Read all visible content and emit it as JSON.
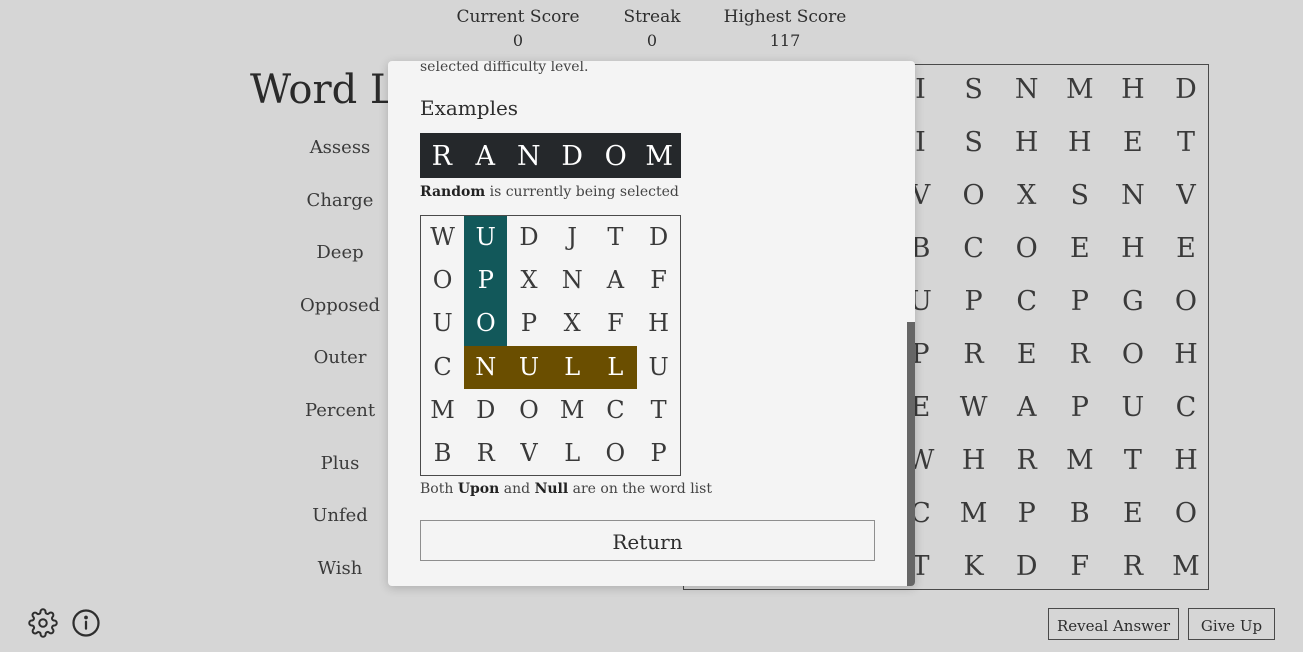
{
  "scores": {
    "current": {
      "label": "Current Score",
      "value": "0"
    },
    "streak": {
      "label": "Streak",
      "value": "0"
    },
    "highest": {
      "label": "Highest Score",
      "value": "117"
    }
  },
  "title": "Word List",
  "words": [
    "Assess",
    "Charge",
    "Deep",
    "Opposed",
    "Outer",
    "Percent",
    "Plus",
    "Unfed",
    "Wish"
  ],
  "grid": [
    [
      "I",
      "S",
      "N",
      "M",
      "H",
      "D"
    ],
    [
      "I",
      "S",
      "H",
      "H",
      "E",
      "T"
    ],
    [
      "V",
      "O",
      "X",
      "S",
      "N",
      "V"
    ],
    [
      "B",
      "C",
      "O",
      "E",
      "H",
      "E"
    ],
    [
      "U",
      "P",
      "C",
      "P",
      "G",
      "O"
    ],
    [
      "P",
      "R",
      "E",
      "R",
      "O",
      "H"
    ],
    [
      "E",
      "W",
      "A",
      "P",
      "U",
      "C"
    ],
    [
      "W",
      "H",
      "R",
      "M",
      "T",
      "H"
    ],
    [
      "C",
      "M",
      "P",
      "B",
      "E",
      "O"
    ],
    [
      "T",
      "K",
      "D",
      "F",
      "R",
      "M"
    ]
  ],
  "buttons": {
    "reveal": "Reveal Answer",
    "give_up": "Give Up"
  },
  "icons": {
    "settings": "gear-icon",
    "info": "info-icon"
  },
  "modal": {
    "fragment": "selected difficulty level.",
    "examples_heading": "Examples",
    "random_letters": [
      "R",
      "A",
      "N",
      "D",
      "O",
      "M"
    ],
    "caption1_bold": "Random",
    "caption1_rest": " is currently being selected",
    "example_grid": [
      [
        "W",
        "U",
        "D",
        "J",
        "T",
        "D"
      ],
      [
        "O",
        "P",
        "X",
        "N",
        "A",
        "F"
      ],
      [
        "U",
        "O",
        "P",
        "X",
        "F",
        "H"
      ],
      [
        "C",
        "N",
        "U",
        "L",
        "L",
        "U"
      ],
      [
        "M",
        "D",
        "O",
        "M",
        "C",
        "T"
      ],
      [
        "B",
        "R",
        "V",
        "L",
        "O",
        "P"
      ]
    ],
    "caption2_pre": "Both ",
    "caption2_b1": "Upon",
    "caption2_mid": " and ",
    "caption2_b2": "Null",
    "caption2_post": " are on the word list",
    "return_label": "Return"
  },
  "colors": {
    "upon_highlight": "#12585a",
    "null_highlight": "#6a4e00",
    "random_bg": "#25282b"
  }
}
